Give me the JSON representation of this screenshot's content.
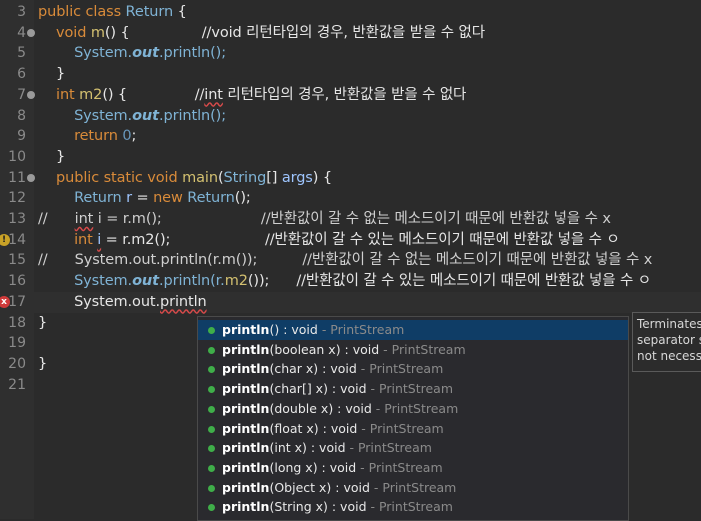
{
  "lines": [
    {
      "num": "3",
      "parts": [
        {
          "t": "public class ",
          "c": "kw"
        },
        {
          "t": "Return",
          "c": "cls"
        },
        {
          "t": " {",
          "c": "ty"
        }
      ]
    },
    {
      "num": "4",
      "fold": true,
      "parts": [
        {
          "t": "    void ",
          "c": "kw"
        },
        {
          "t": "m",
          "c": "mth"
        },
        {
          "t": "() {                //void 리턴타입의 경우, 반환값을 받을 수 없다",
          "c": "ty"
        }
      ]
    },
    {
      "num": "5",
      "parts": [
        {
          "t": "        System.",
          "c": "cls"
        },
        {
          "t": "out",
          "c": "fld"
        },
        {
          "t": ".println();",
          "c": "cls"
        }
      ]
    },
    {
      "num": "6",
      "parts": [
        {
          "t": "    }",
          "c": "ty"
        }
      ]
    },
    {
      "num": "7",
      "fold": true,
      "parts": [
        {
          "t": "    int ",
          "c": "kw"
        },
        {
          "t": "m2",
          "c": "mth"
        },
        {
          "t": "() {               //",
          "c": "ty"
        },
        {
          "t": "int",
          "c": "ty",
          "sq": true
        },
        {
          "t": " 리턴타입의 경우, 반환값을 받을 수 없다",
          "c": "ty"
        }
      ]
    },
    {
      "num": "8",
      "parts": [
        {
          "t": "        System.",
          "c": "cls"
        },
        {
          "t": "out",
          "c": "fld"
        },
        {
          "t": ".println();",
          "c": "cls"
        }
      ]
    },
    {
      "num": "9",
      "parts": [
        {
          "t": "        return ",
          "c": "kw"
        },
        {
          "t": "0",
          "c": "num"
        },
        {
          "t": ";",
          "c": "ty"
        }
      ]
    },
    {
      "num": "10",
      "parts": [
        {
          "t": "    }",
          "c": "ty"
        }
      ]
    },
    {
      "num": "11",
      "fold": true,
      "parts": [
        {
          "t": "    public static void ",
          "c": "kw"
        },
        {
          "t": "main",
          "c": "mth"
        },
        {
          "t": "(",
          "c": "ty"
        },
        {
          "t": "String",
          "c": "cls"
        },
        {
          "t": "[] ",
          "c": "ty"
        },
        {
          "t": "args",
          "c": "var"
        },
        {
          "t": ") {",
          "c": "ty"
        }
      ]
    },
    {
      "num": "12",
      "parts": [
        {
          "t": "        Return ",
          "c": "cls"
        },
        {
          "t": "r",
          "c": "var"
        },
        {
          "t": " = ",
          "c": "ty"
        },
        {
          "t": "new ",
          "c": "kw"
        },
        {
          "t": "Return",
          "c": "cls"
        },
        {
          "t": "();",
          "c": "ty"
        }
      ]
    },
    {
      "num": "13",
      "parts": [
        {
          "t": "//      ",
          "c": "cmt"
        },
        {
          "t": "int",
          "c": "cmt",
          "sq": true
        },
        {
          "t": " i = r.m();                      //반환값이 갈 수 없는 메소드이기 때문에 반환값 넣을 수 x",
          "c": "cmt"
        }
      ]
    },
    {
      "num": "14",
      "marker": "warn",
      "parts": [
        {
          "t": "        int ",
          "c": "kw"
        },
        {
          "t": "i",
          "c": "var",
          "sq": true
        },
        {
          "t": " = r.m2();                     //반환값이 갈 수 있는 메소드이기 때문에 반환값 넣을 수 ㅇ",
          "c": "ty"
        }
      ]
    },
    {
      "num": "15",
      "parts": [
        {
          "t": "//      System.out.println(r.m());          //반환값이 갈 수 없는 메소드이기 때문에 반환값 넣을 수 x",
          "c": "cmt"
        }
      ]
    },
    {
      "num": "16",
      "parts": [
        {
          "t": "        System.",
          "c": "cls"
        },
        {
          "t": "out",
          "c": "fld"
        },
        {
          "t": ".println(r.",
          "c": "cls"
        },
        {
          "t": "m2",
          "c": "mth"
        },
        {
          "t": "());      //반환값이 갈 수 있는 메소드이기 때문에 반환값 넣을 수 ㅇ",
          "c": "ty"
        }
      ]
    },
    {
      "num": "17",
      "marker": "err",
      "current": true,
      "parts": [
        {
          "t": "        System.out.",
          "c": "ty"
        },
        {
          "t": "println",
          "c": "ty",
          "sq": true
        }
      ]
    },
    {
      "num": "18",
      "parts": [
        {
          "t": "}",
          "c": "ty"
        }
      ]
    },
    {
      "num": "19",
      "parts": []
    },
    {
      "num": "20",
      "parts": [
        {
          "t": "}",
          "c": "ty"
        }
      ]
    },
    {
      "num": "21",
      "parts": []
    }
  ],
  "completions": [
    {
      "name": "println",
      "args": "() : void",
      "owner": "PrintStream",
      "selected": true
    },
    {
      "name": "println",
      "args": "(boolean x) : void",
      "owner": "PrintStream"
    },
    {
      "name": "println",
      "args": "(char x) : void",
      "owner": "PrintStream"
    },
    {
      "name": "println",
      "args": "(char[] x) : void",
      "owner": "PrintStream"
    },
    {
      "name": "println",
      "args": "(double x) : void",
      "owner": "PrintStream"
    },
    {
      "name": "println",
      "args": "(float x) : void",
      "owner": "PrintStream"
    },
    {
      "name": "println",
      "args": "(int x) : void",
      "owner": "PrintStream"
    },
    {
      "name": "println",
      "args": "(long x) : void",
      "owner": "PrintStream"
    },
    {
      "name": "println",
      "args": "(Object x) : void",
      "owner": "PrintStream"
    },
    {
      "name": "println",
      "args": "(String x) : void",
      "owner": "PrintStream"
    }
  ],
  "doc_lines": [
    "Terminates",
    "separator s",
    "not necessa"
  ],
  "separator": " - ",
  "marker_glyphs": {
    "warn": "!",
    "err": "x"
  }
}
